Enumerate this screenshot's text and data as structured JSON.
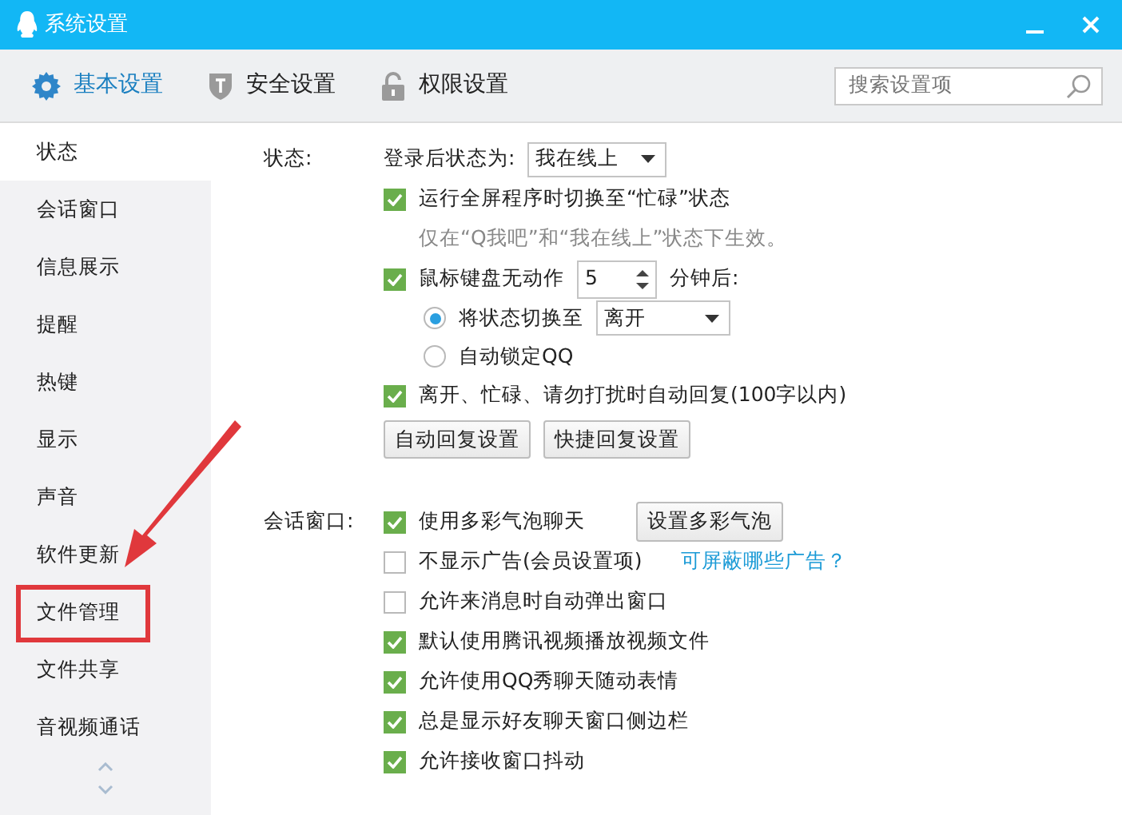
{
  "window": {
    "title": "系统设置"
  },
  "tabs": [
    {
      "label": "基本设置",
      "selected": true
    },
    {
      "label": "安全设置",
      "selected": false
    },
    {
      "label": "权限设置",
      "selected": false
    }
  ],
  "search": {
    "placeholder": "搜索设置项"
  },
  "sidebar": {
    "items": [
      {
        "label": "状态",
        "selected": true,
        "highlighted": false
      },
      {
        "label": "会话窗口",
        "selected": false,
        "highlighted": false
      },
      {
        "label": "信息展示",
        "selected": false,
        "highlighted": false
      },
      {
        "label": "提醒",
        "selected": false,
        "highlighted": false
      },
      {
        "label": "热键",
        "selected": false,
        "highlighted": false
      },
      {
        "label": "显示",
        "selected": false,
        "highlighted": false
      },
      {
        "label": "声音",
        "selected": false,
        "highlighted": false
      },
      {
        "label": "软件更新",
        "selected": false,
        "highlighted": false
      },
      {
        "label": "文件管理",
        "selected": false,
        "highlighted": true
      },
      {
        "label": "文件共享",
        "selected": false,
        "highlighted": false
      },
      {
        "label": "音视频通话",
        "selected": false,
        "highlighted": false
      }
    ]
  },
  "sections": [
    {
      "label": "状态:",
      "rows": [
        {
          "kind": "select",
          "label": "登录后状态为:",
          "value": "我在线上"
        },
        {
          "kind": "checkbox",
          "label": "运行全屏程序时切换至“忙碌”状态",
          "checked": true
        },
        {
          "kind": "note",
          "text": "仅在“Q我吧”和“我在线上”状态下生效。"
        },
        {
          "kind": "spinner",
          "label": "鼠标键盘无动作",
          "checked": true,
          "value": "5",
          "suffix": "分钟后:"
        },
        {
          "kind": "radio",
          "label": "将状态切换至",
          "selected": true,
          "value": "离开"
        },
        {
          "kind": "radio",
          "label": "自动锁定QQ",
          "selected": false
        },
        {
          "kind": "checkbox",
          "label": "离开、忙碌、请勿打扰时自动回复(100字以内)",
          "checked": true
        },
        {
          "kind": "buttons",
          "buttons": [
            "自动回复设置",
            "快捷回复设置"
          ]
        }
      ]
    },
    {
      "label": "会话窗口:",
      "rows": [
        {
          "kind": "checkbox",
          "label": "使用多彩气泡聊天",
          "checked": true,
          "button": "设置多彩气泡"
        },
        {
          "kind": "checkbox",
          "label": "不显示广告(会员设置项)",
          "checked": false,
          "link": "可屏蔽哪些广告？"
        },
        {
          "kind": "checkbox",
          "label": "允许来消息时自动弹出窗口",
          "checked": false
        },
        {
          "kind": "checkbox",
          "label": "默认使用腾讯视频播放视频文件",
          "checked": true
        },
        {
          "kind": "checkbox",
          "label": "允许使用QQ秀聊天随动表情",
          "checked": true
        },
        {
          "kind": "checkbox",
          "label": "总是显示好友聊天窗口侧边栏",
          "checked": true
        },
        {
          "kind": "checkbox",
          "label": "允许接收窗口抖动",
          "checked": true
        }
      ]
    }
  ]
}
